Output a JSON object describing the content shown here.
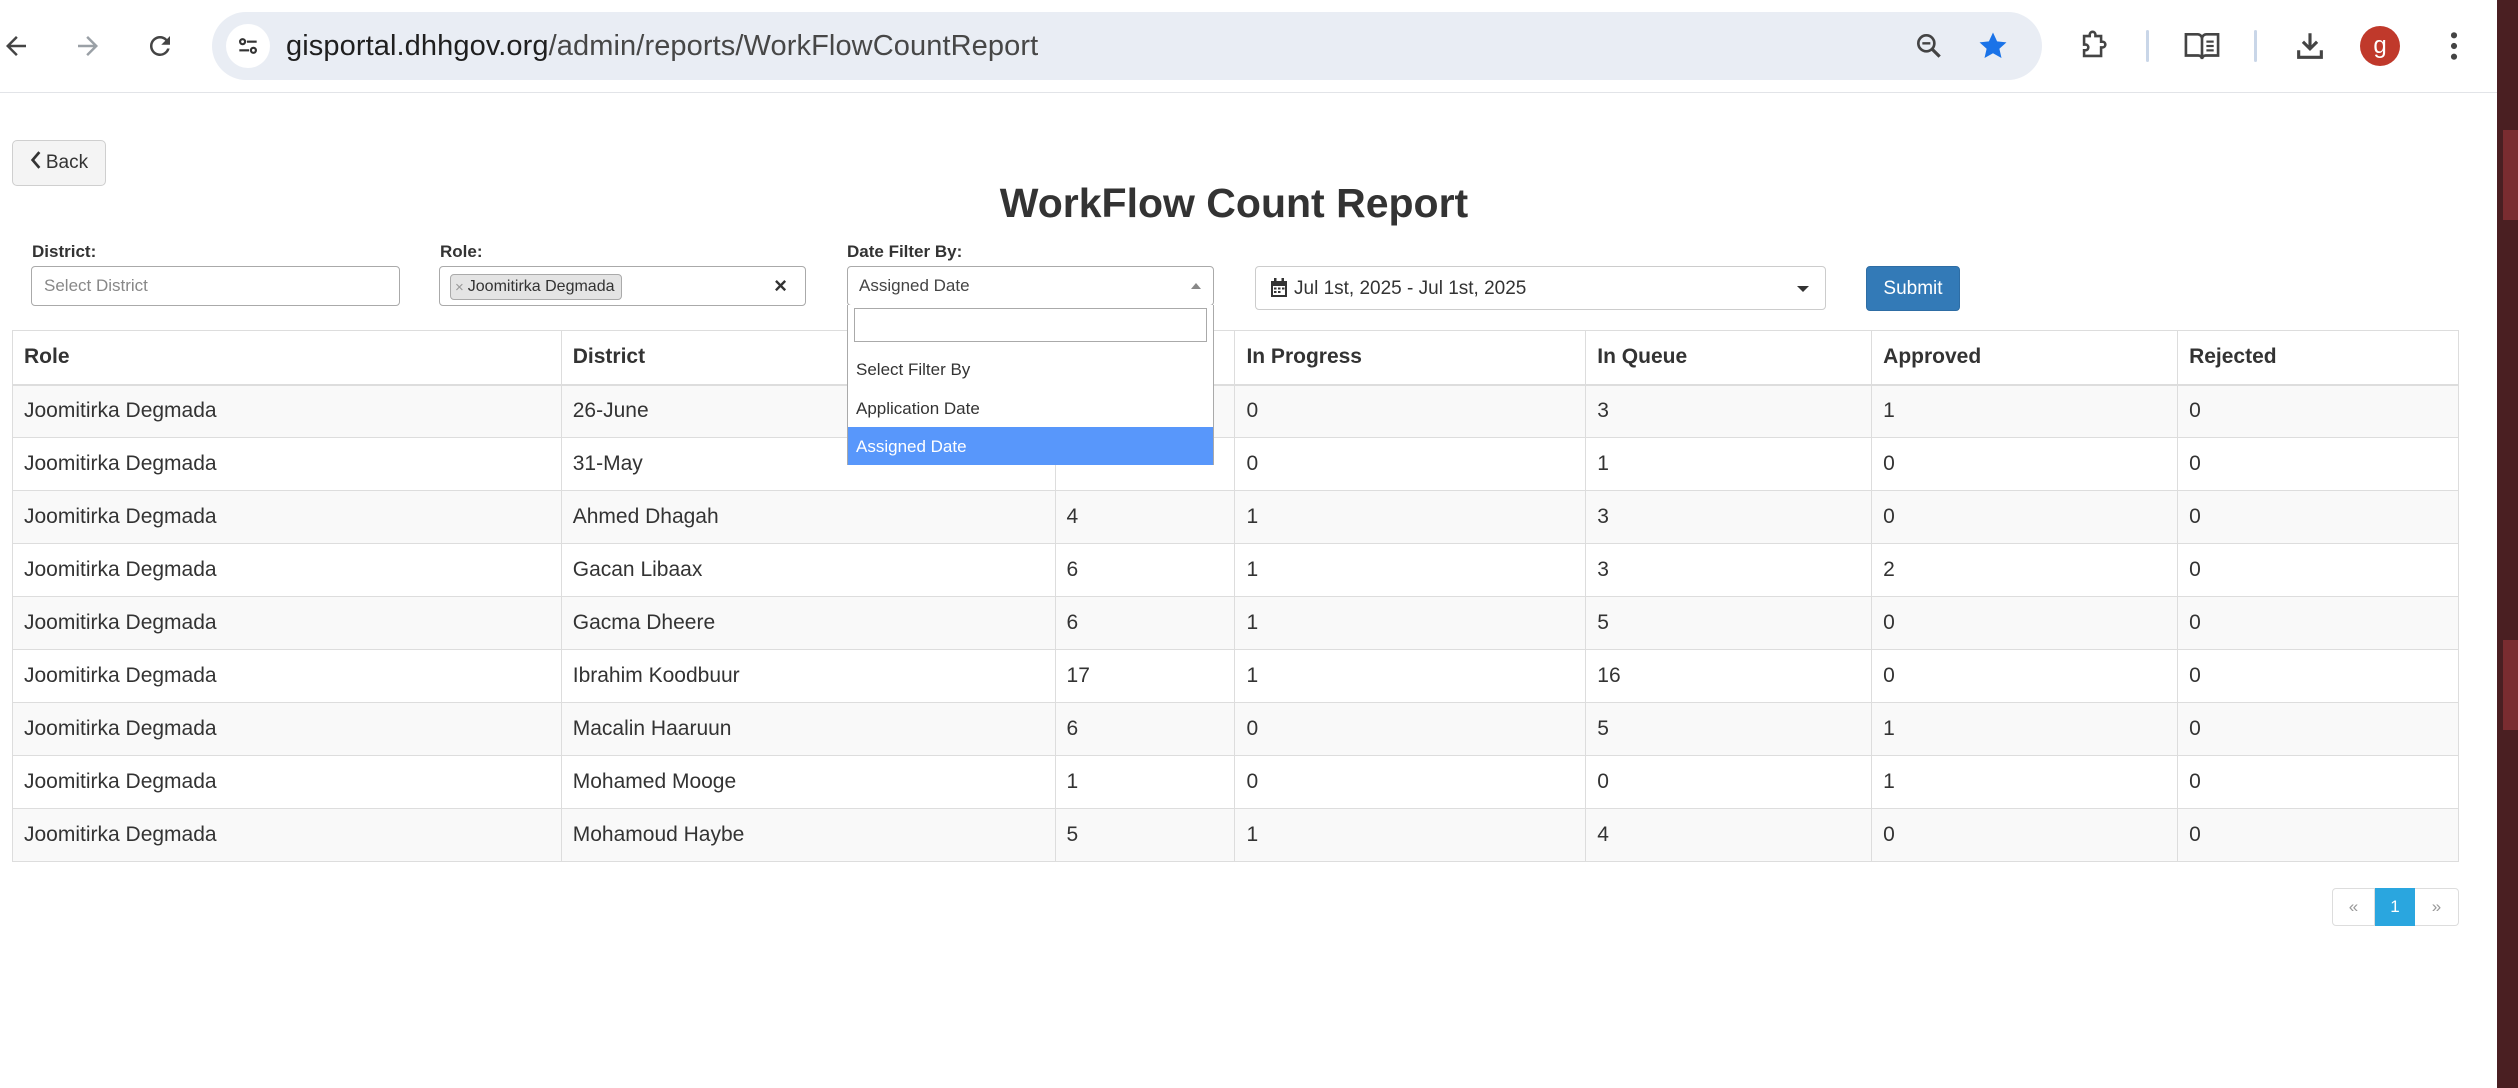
{
  "browser": {
    "url_host": "gisportal.dhhgov.org",
    "url_path": "/admin/reports/WorkFlowCountReport",
    "profile_initial": "g",
    "icons": [
      "back-arrow-icon",
      "forward-arrow-icon",
      "reload-icon",
      "site-settings-icon",
      "zoom-icon",
      "bookmark-star-icon",
      "extensions-icon",
      "reading-mode-icon",
      "download-icon",
      "more-menu-icon"
    ],
    "accent_color": "#1a73e8"
  },
  "page": {
    "back_label": "Back",
    "title": "WorkFlow Count Report"
  },
  "filters": {
    "district_label": "District:",
    "district_placeholder": "Select District",
    "role_label": "Role:",
    "role_tag": "Joomitirka Degmada",
    "role_tag_remove": "×",
    "role_clear": "×",
    "date_filter_label": "Date Filter By:",
    "date_filter_value": "Assigned Date",
    "date_filter_options": [
      "Select Filter By",
      "Application Date",
      "Assigned Date"
    ],
    "date_range": "Jul 1st, 2025 - Jul 1st, 2025",
    "submit_label": "Submit"
  },
  "table": {
    "headers": [
      "Role",
      "District",
      "",
      "In Progress",
      "In Queue",
      "Approved",
      "Rejected"
    ],
    "rows": [
      [
        "Joomitirka Degmada",
        "26-June",
        "",
        "0",
        "3",
        "1",
        "0"
      ],
      [
        "Joomitirka Degmada",
        "31-May",
        "",
        "0",
        "1",
        "0",
        "0"
      ],
      [
        "Joomitirka Degmada",
        "Ahmed Dhagah",
        "4",
        "1",
        "3",
        "0",
        "0"
      ],
      [
        "Joomitirka Degmada",
        "Gacan Libaax",
        "6",
        "1",
        "3",
        "2",
        "0"
      ],
      [
        "Joomitirka Degmada",
        "Gacma Dheere",
        "6",
        "1",
        "5",
        "0",
        "0"
      ],
      [
        "Joomitirka Degmada",
        "Ibrahim Koodbuur",
        "17",
        "1",
        "16",
        "0",
        "0"
      ],
      [
        "Joomitirka Degmada",
        "Macalin Haaruun",
        "6",
        "0",
        "5",
        "1",
        "0"
      ],
      [
        "Joomitirka Degmada",
        "Mohamed Mooge",
        "1",
        "0",
        "0",
        "1",
        "0"
      ],
      [
        "Joomitirka Degmada",
        "Mohamoud Haybe",
        "5",
        "1",
        "4",
        "0",
        "0"
      ]
    ]
  },
  "pagination": {
    "prev": "«",
    "current": "1",
    "next": "»"
  }
}
